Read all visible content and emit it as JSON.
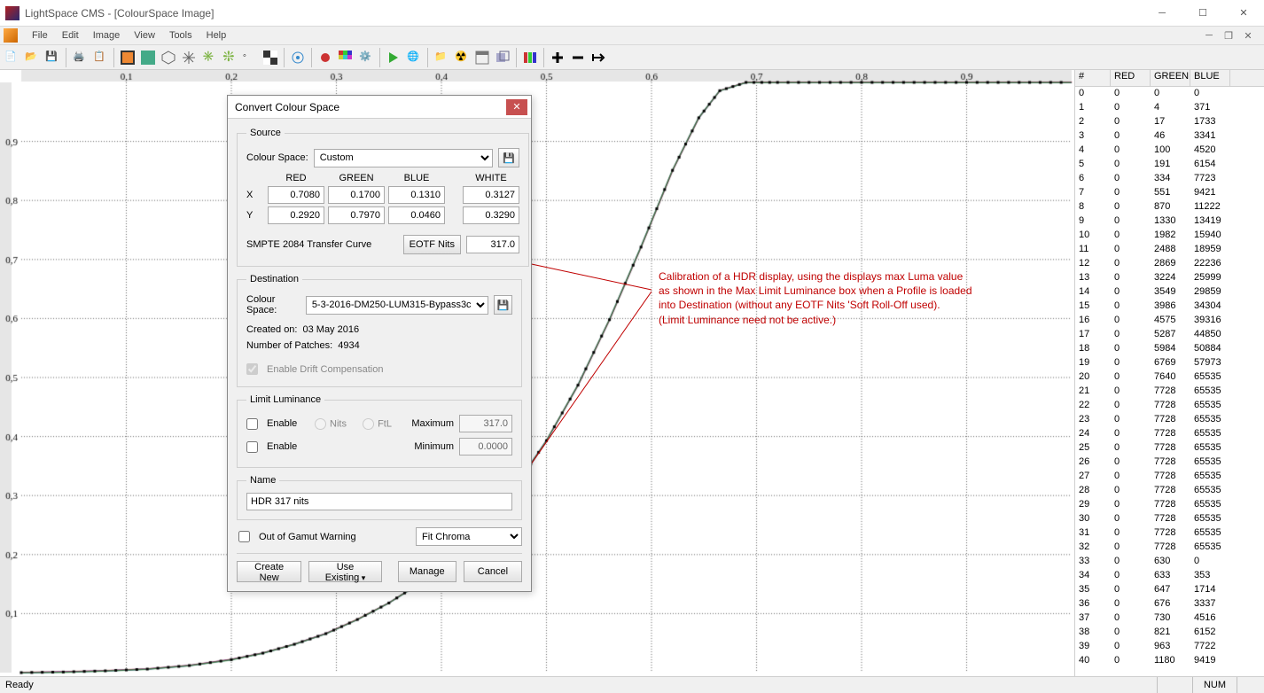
{
  "window": {
    "title": "LightSpace CMS - [ColourSpace Image]"
  },
  "menu": [
    "File",
    "Edit",
    "Image",
    "View",
    "Tools",
    "Help"
  ],
  "status": {
    "ready": "Ready",
    "num": "NUM"
  },
  "chart_data": {
    "type": "line",
    "xlabel": "",
    "ylabel": "",
    "xlim": [
      0,
      1
    ],
    "ylim": [
      0,
      1
    ],
    "xticks": [
      0.1,
      0.2,
      0.3,
      0.4,
      0.5,
      0.6,
      0.7,
      0.8,
      0.9
    ],
    "yticks": [
      0.1,
      0.2,
      0.3,
      0.4,
      0.5,
      0.6,
      0.7,
      0.8,
      0.9
    ],
    "series": [
      {
        "name": "curve",
        "points": [
          [
            0.0,
            0.0
          ],
          [
            0.04,
            0.001
          ],
          [
            0.08,
            0.003
          ],
          [
            0.12,
            0.006
          ],
          [
            0.16,
            0.012
          ],
          [
            0.2,
            0.022
          ],
          [
            0.23,
            0.033
          ],
          [
            0.26,
            0.048
          ],
          [
            0.29,
            0.066
          ],
          [
            0.32,
            0.09
          ],
          [
            0.35,
            0.118
          ],
          [
            0.38,
            0.152
          ],
          [
            0.41,
            0.195
          ],
          [
            0.44,
            0.248
          ],
          [
            0.47,
            0.314
          ],
          [
            0.5,
            0.393
          ],
          [
            0.53,
            0.487
          ],
          [
            0.56,
            0.598
          ],
          [
            0.59,
            0.721
          ],
          [
            0.62,
            0.851
          ],
          [
            0.645,
            0.94
          ],
          [
            0.665,
            0.986
          ],
          [
            0.69,
            1.0
          ],
          [
            0.72,
            1.0
          ],
          [
            0.76,
            1.0
          ],
          [
            0.8,
            1.0
          ],
          [
            0.84,
            1.0
          ],
          [
            0.88,
            1.0
          ],
          [
            0.92,
            1.0
          ],
          [
            0.96,
            1.0
          ],
          [
            1.0,
            1.0
          ]
        ]
      }
    ]
  },
  "table": {
    "headers": [
      "#",
      "RED",
      "GREEN",
      "BLUE"
    ],
    "rows": [
      [
        "0",
        "0",
        "0",
        "0"
      ],
      [
        "1",
        "0",
        "4",
        "371"
      ],
      [
        "2",
        "0",
        "17",
        "1733"
      ],
      [
        "3",
        "0",
        "46",
        "3341"
      ],
      [
        "4",
        "0",
        "100",
        "4520"
      ],
      [
        "5",
        "0",
        "191",
        "6154"
      ],
      [
        "6",
        "0",
        "334",
        "7723"
      ],
      [
        "7",
        "0",
        "551",
        "9421"
      ],
      [
        "8",
        "0",
        "870",
        "11222"
      ],
      [
        "9",
        "0",
        "1330",
        "13419"
      ],
      [
        "10",
        "0",
        "1982",
        "15940"
      ],
      [
        "11",
        "0",
        "2488",
        "18959"
      ],
      [
        "12",
        "0",
        "2869",
        "22236"
      ],
      [
        "13",
        "0",
        "3224",
        "25999"
      ],
      [
        "14",
        "0",
        "3549",
        "29859"
      ],
      [
        "15",
        "0",
        "3986",
        "34304"
      ],
      [
        "16",
        "0",
        "4575",
        "39316"
      ],
      [
        "17",
        "0",
        "5287",
        "44850"
      ],
      [
        "18",
        "0",
        "5984",
        "50884"
      ],
      [
        "19",
        "0",
        "6769",
        "57973"
      ],
      [
        "20",
        "0",
        "7640",
        "65535"
      ],
      [
        "21",
        "0",
        "7728",
        "65535"
      ],
      [
        "22",
        "0",
        "7728",
        "65535"
      ],
      [
        "23",
        "0",
        "7728",
        "65535"
      ],
      [
        "24",
        "0",
        "7728",
        "65535"
      ],
      [
        "25",
        "0",
        "7728",
        "65535"
      ],
      [
        "26",
        "0",
        "7728",
        "65535"
      ],
      [
        "27",
        "0",
        "7728",
        "65535"
      ],
      [
        "28",
        "0",
        "7728",
        "65535"
      ],
      [
        "29",
        "0",
        "7728",
        "65535"
      ],
      [
        "30",
        "0",
        "7728",
        "65535"
      ],
      [
        "31",
        "0",
        "7728",
        "65535"
      ],
      [
        "32",
        "0",
        "7728",
        "65535"
      ],
      [
        "33",
        "0",
        "630",
        "0"
      ],
      [
        "34",
        "0",
        "633",
        "353"
      ],
      [
        "35",
        "0",
        "647",
        "1714"
      ],
      [
        "36",
        "0",
        "676",
        "3337"
      ],
      [
        "37",
        "0",
        "730",
        "4516"
      ],
      [
        "38",
        "0",
        "821",
        "6152"
      ],
      [
        "39",
        "0",
        "963",
        "7722"
      ],
      [
        "40",
        "0",
        "1180",
        "9419"
      ]
    ]
  },
  "dialog": {
    "title": "Convert Colour Space",
    "source": {
      "legend": "Source",
      "cs_label": "Colour Space:",
      "cs_value": "Custom",
      "hdr": {
        "red": "RED",
        "green": "GREEN",
        "blue": "BLUE",
        "white": "WHITE"
      },
      "rowX": "X",
      "rowY": "Y",
      "x": {
        "red": "0.7080",
        "green": "0.1700",
        "blue": "0.1310",
        "white": "0.3127"
      },
      "y": {
        "red": "0.2920",
        "green": "0.7970",
        "blue": "0.0460",
        "white": "0.3290"
      },
      "smpte": "SMPTE 2084 Transfer Curve",
      "eotf_btn": "EOTF Nits",
      "eotf_val": "317.0"
    },
    "dest": {
      "legend": "Destination",
      "cs_label": "Colour Space:",
      "cs_value": "5-3-2016-DM250-LUM315-Bypass3c",
      "created_lbl": "Created on: ",
      "created_val": "03 May 2016",
      "patches_lbl": "Number of Patches: ",
      "patches_val": "4934",
      "drift": "Enable Drift Compensation"
    },
    "limit": {
      "legend": "Limit Luminance",
      "enable": "Enable",
      "nits": "Nits",
      "ftl": "FtL",
      "max_lbl": "Maximum",
      "max_val": "317.0",
      "min_lbl": "Minimum",
      "min_val": "0.0000"
    },
    "name": {
      "legend": "Name",
      "value": "HDR 317 nits"
    },
    "gamut": {
      "chk": "Out of Gamut Warning",
      "sel": "Fit Chroma"
    },
    "btns": {
      "createnew": "Create New",
      "useexisting": "Use Existing",
      "manage": "Manage",
      "cancel": "Cancel"
    }
  },
  "annotation": {
    "text1": "Calibration of a HDR display, using the displays max Luma value",
    "text2": "as shown in the Max Limit Luminance box when a Profile is loaded",
    "text3": "into Destination (without any EOTF Nits 'Soft Roll-Off used).",
    "text4": "(Limit Luminance need not be active.)"
  }
}
